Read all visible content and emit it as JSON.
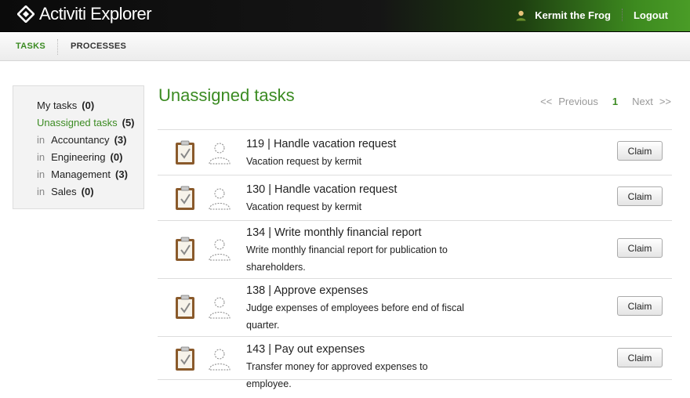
{
  "header": {
    "app_title": "Activiti Explorer",
    "user_name": "Kermit the Frog",
    "logout_label": "Logout"
  },
  "nav": {
    "tabs": [
      {
        "label": "TASKS",
        "active": true
      },
      {
        "label": "PROCESSES",
        "active": false
      }
    ]
  },
  "sidebar": {
    "items": [
      {
        "prefix": "",
        "label": "My tasks",
        "count": "(0)",
        "active": false
      },
      {
        "prefix": "",
        "label": "Unassigned tasks",
        "count": "(5)",
        "active": true
      },
      {
        "prefix": "in",
        "label": "Accountancy",
        "count": "(3)",
        "active": false
      },
      {
        "prefix": "in",
        "label": "Engineering",
        "count": "(0)",
        "active": false
      },
      {
        "prefix": "in",
        "label": "Management",
        "count": "(3)",
        "active": false
      },
      {
        "prefix": "in",
        "label": "Sales",
        "count": "(0)",
        "active": false
      }
    ]
  },
  "main": {
    "title": "Unassigned tasks",
    "pager": {
      "prev_arrows": "<<",
      "prev_label": "Previous",
      "page": "1",
      "next_label": "Next",
      "next_arrows": ">>"
    },
    "tasks": [
      {
        "title": "119 | Handle vacation request",
        "description": "Vacation request by kermit",
        "action": "Claim"
      },
      {
        "title": "130 | Handle vacation request",
        "description": "Vacation request by kermit",
        "action": "Claim"
      },
      {
        "title": "134 | Write monthly financial report",
        "description": "Write monthly financial report for publication to shareholders.",
        "action": "Claim"
      },
      {
        "title": "138 | Approve expenses",
        "description": "Judge expenses of employees before end of fiscal quarter.",
        "action": "Claim"
      },
      {
        "title": "143 | Pay out expenses",
        "description": "Transfer money for approved expenses to employee.",
        "action": "Claim"
      }
    ]
  },
  "colors": {
    "accent": "#3b8b22",
    "header_bg": "#111111"
  },
  "icons": {
    "task": "clipboard-check-icon",
    "assignee": "person-placeholder-icon",
    "user": "user-avatar-icon",
    "logo": "activiti-diamond-icon"
  }
}
